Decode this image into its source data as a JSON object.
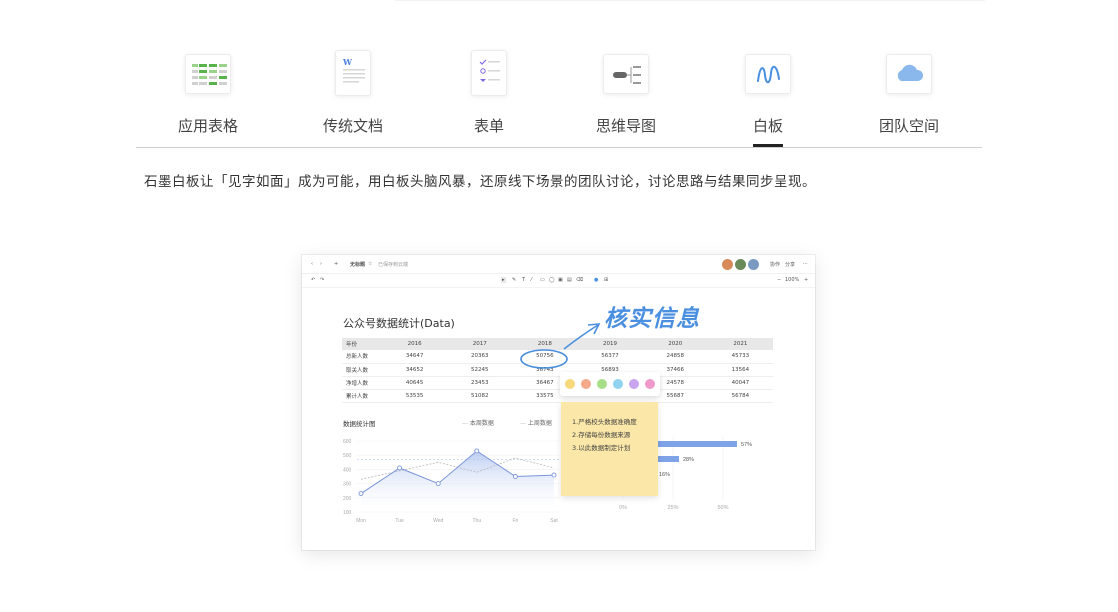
{
  "tabs": [
    {
      "label": "应用表格",
      "icon": "spreadsheet-icon",
      "active": false
    },
    {
      "label": "传统文档",
      "icon": "word-document-icon",
      "active": false
    },
    {
      "label": "表单",
      "icon": "form-icon",
      "active": false
    },
    {
      "label": "思维导图",
      "icon": "mindmap-icon",
      "active": false
    },
    {
      "label": "白板",
      "icon": "whiteboard-icon",
      "active": true
    },
    {
      "label": "团队空间",
      "icon": "cloud-icon",
      "active": false
    }
  ],
  "intro": "石墨白板让「见字如面」成为可能，用白板头脑风暴，还原线下场景的团队讨论，讨论思路与结果同步呈现。",
  "colors": {
    "accent": "#4a8fe0",
    "sticky": "#fbe7a7",
    "bar": "#7ea3e6"
  },
  "mock": {
    "window_title": "无标题",
    "save_status": "已保存到云端",
    "titlebar_buttons": [
      "协作",
      "分享"
    ],
    "zoom": "100%",
    "doc_title": "公众号数据统计(Data)",
    "handwritten_note": "核实信息",
    "palette_colors": [
      "#f6d97a",
      "#f4a98a",
      "#a8de8a",
      "#8fd3ee",
      "#c9a4ef",
      "#f09acb"
    ],
    "sticky_lines": [
      "1.严格校头数据准确度",
      "2.存储每份数据来源",
      "3.以此数据制定计划"
    ],
    "table": {
      "headers": [
        "年份",
        "2016",
        "2017",
        "2018",
        "2019",
        "2020",
        "2021"
      ],
      "rows": [
        [
          "总新人数",
          "34647",
          "20363",
          "50756",
          "56377",
          "24858",
          "45733"
        ],
        [
          "取关人数",
          "34652",
          "52245",
          "36743",
          "56893",
          "37466",
          "13564"
        ],
        [
          "净增人数",
          "40645",
          "23453",
          "36467",
          "",
          "24578",
          "40047"
        ],
        [
          "累计人数",
          "53535",
          "51082",
          "33575",
          "",
          "55687",
          "56784"
        ]
      ]
    },
    "chart": {
      "title": "数据统计图",
      "legend": [
        "本周数据",
        "上周数据"
      ]
    }
  },
  "chart_data": [
    {
      "type": "line",
      "title": "数据统计图",
      "categories": [
        "Mon",
        "Tue",
        "Wed",
        "Thu",
        "Fri",
        "Sat"
      ],
      "ylim": [
        100,
        600
      ],
      "yticks": [
        "600",
        "500",
        "400",
        "300",
        "200",
        "100"
      ],
      "series": [
        {
          "name": "本周数据",
          "values": [
            230,
            410,
            300,
            530,
            350,
            360
          ]
        },
        {
          "name": "上周数据",
          "values": [
            330,
            390,
            450,
            380,
            480,
            410
          ]
        }
      ]
    },
    {
      "type": "bar",
      "orientation": "horizontal",
      "xticks": [
        "0%",
        "25%",
        "50%"
      ],
      "xlim": [
        0,
        60
      ],
      "values": [
        57,
        28,
        16
      ],
      "data_labels": [
        "57%",
        "28%",
        "16%"
      ]
    }
  ]
}
